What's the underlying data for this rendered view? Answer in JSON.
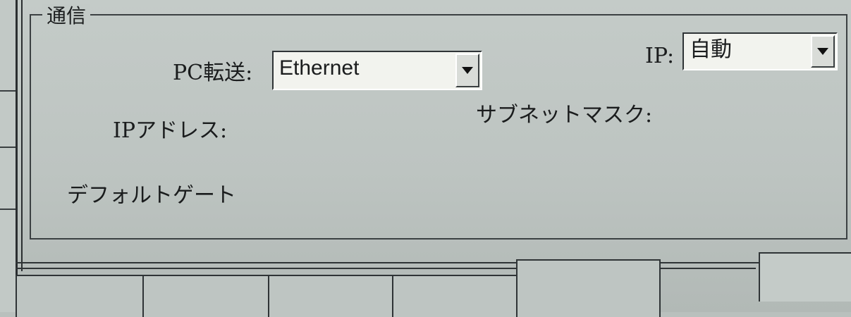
{
  "group": {
    "title": "通信"
  },
  "pc_transfer": {
    "label": "PC転送:",
    "value": "Ethernet"
  },
  "ip_mode": {
    "label": "IP:",
    "value": "自動"
  },
  "fields": {
    "ip_address": "IPアドレス:",
    "subnet_mask": "サブネットマスク:",
    "default_gateway": "デフォルトゲート"
  }
}
